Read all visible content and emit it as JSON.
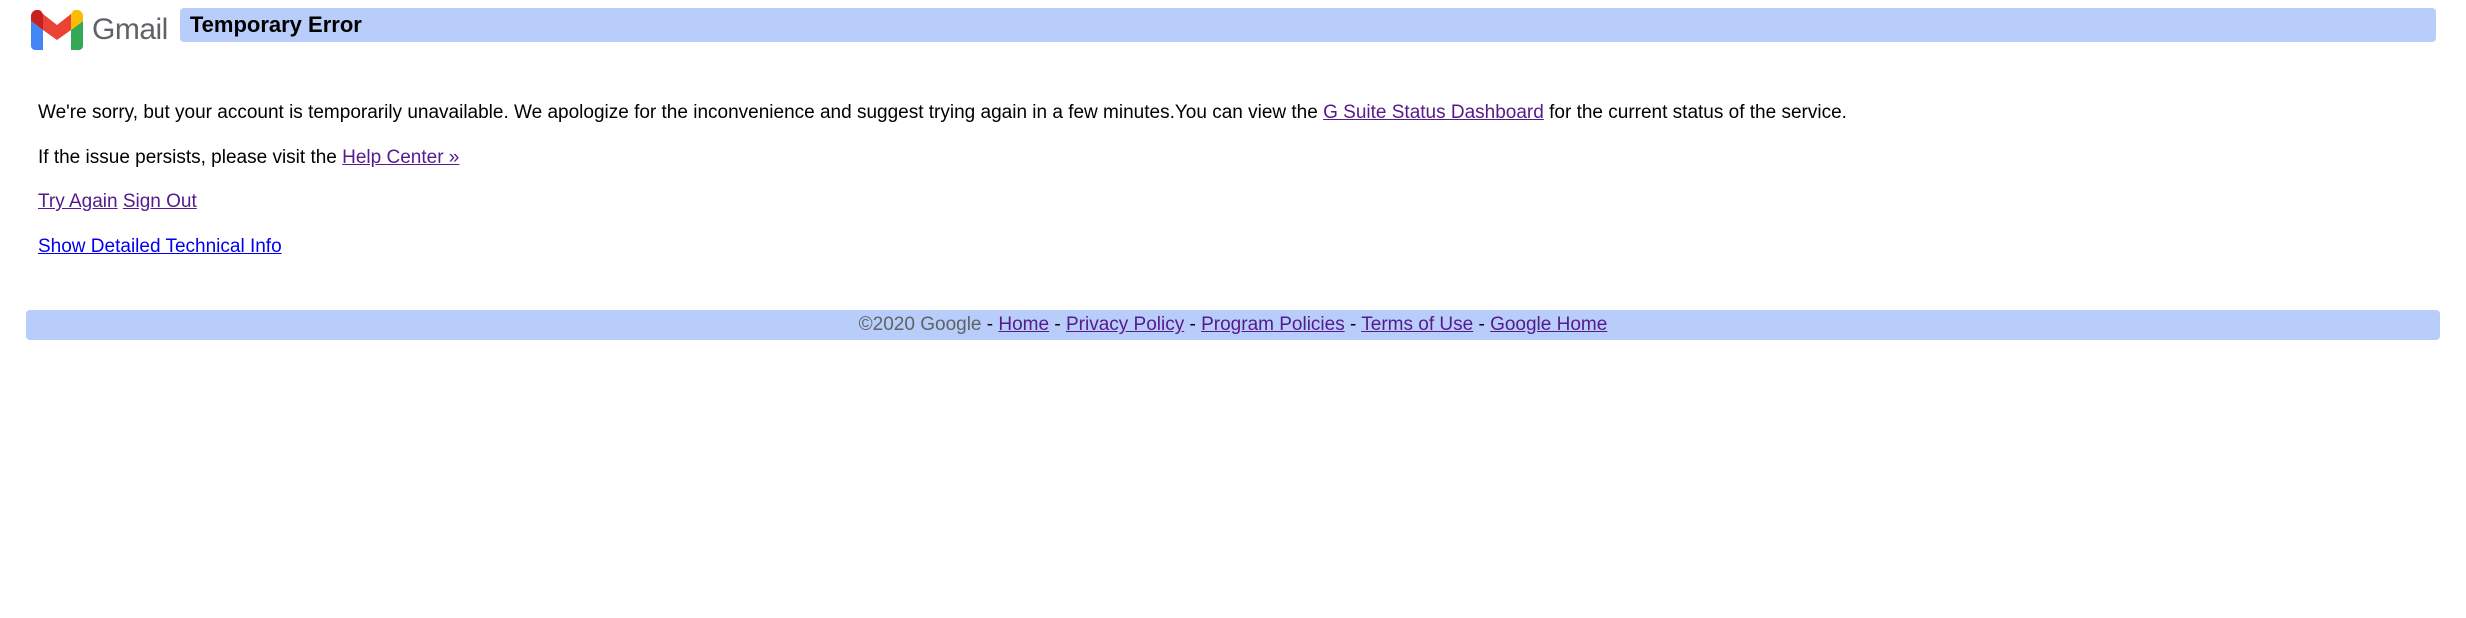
{
  "header": {
    "logo_text": "Gmail",
    "error_title": "Temporary Error"
  },
  "content": {
    "apology_text_1": "We're sorry, but your account is temporarily unavailable. We apologize for the inconvenience and suggest trying again in a few minutes.You can view the ",
    "status_dashboard_link": "G Suite Status Dashboard",
    "apology_text_2": " for the current status of the service.",
    "help_text_1": "If the issue persists, please visit the ",
    "help_center_link": "Help Center »",
    "try_again_link": "Try Again",
    "sign_out_link": "Sign Out",
    "tech_info_link": "Show Detailed Technical Info"
  },
  "footer": {
    "copyright": "©2020 Google",
    "links": {
      "home": "Home",
      "privacy": "Privacy Policy",
      "program": "Program Policies",
      "terms": "Terms of Use",
      "google_home": "Google Home"
    }
  }
}
